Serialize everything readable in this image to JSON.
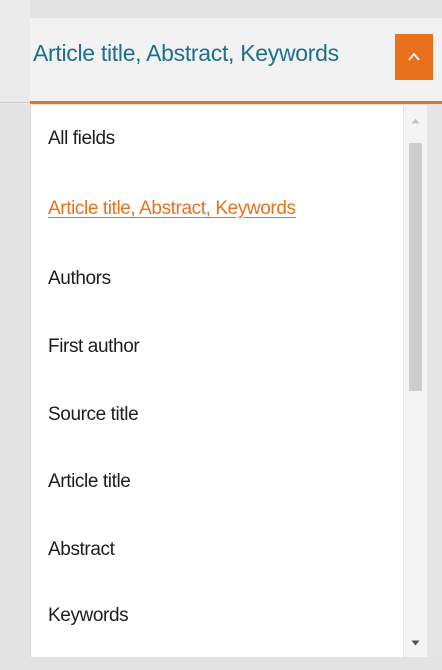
{
  "search_field": {
    "selected_label": "Article title, Abstract, Keywords",
    "toggle_icon": "chevron-up-icon"
  },
  "dropdown": {
    "options": [
      {
        "label": "All fields",
        "selected": false
      },
      {
        "label": "Article title, Abstract, Keywords",
        "selected": true
      },
      {
        "label": "Authors",
        "selected": false
      },
      {
        "label": "First author",
        "selected": false
      },
      {
        "label": "Source title",
        "selected": false
      },
      {
        "label": "Article title",
        "selected": false
      },
      {
        "label": "Abstract",
        "selected": false
      },
      {
        "label": "Keywords",
        "selected": false
      }
    ]
  },
  "colors": {
    "accent": "#e9711c",
    "field_text": "#1f6f8b",
    "option_text": "#1d1d1d"
  }
}
